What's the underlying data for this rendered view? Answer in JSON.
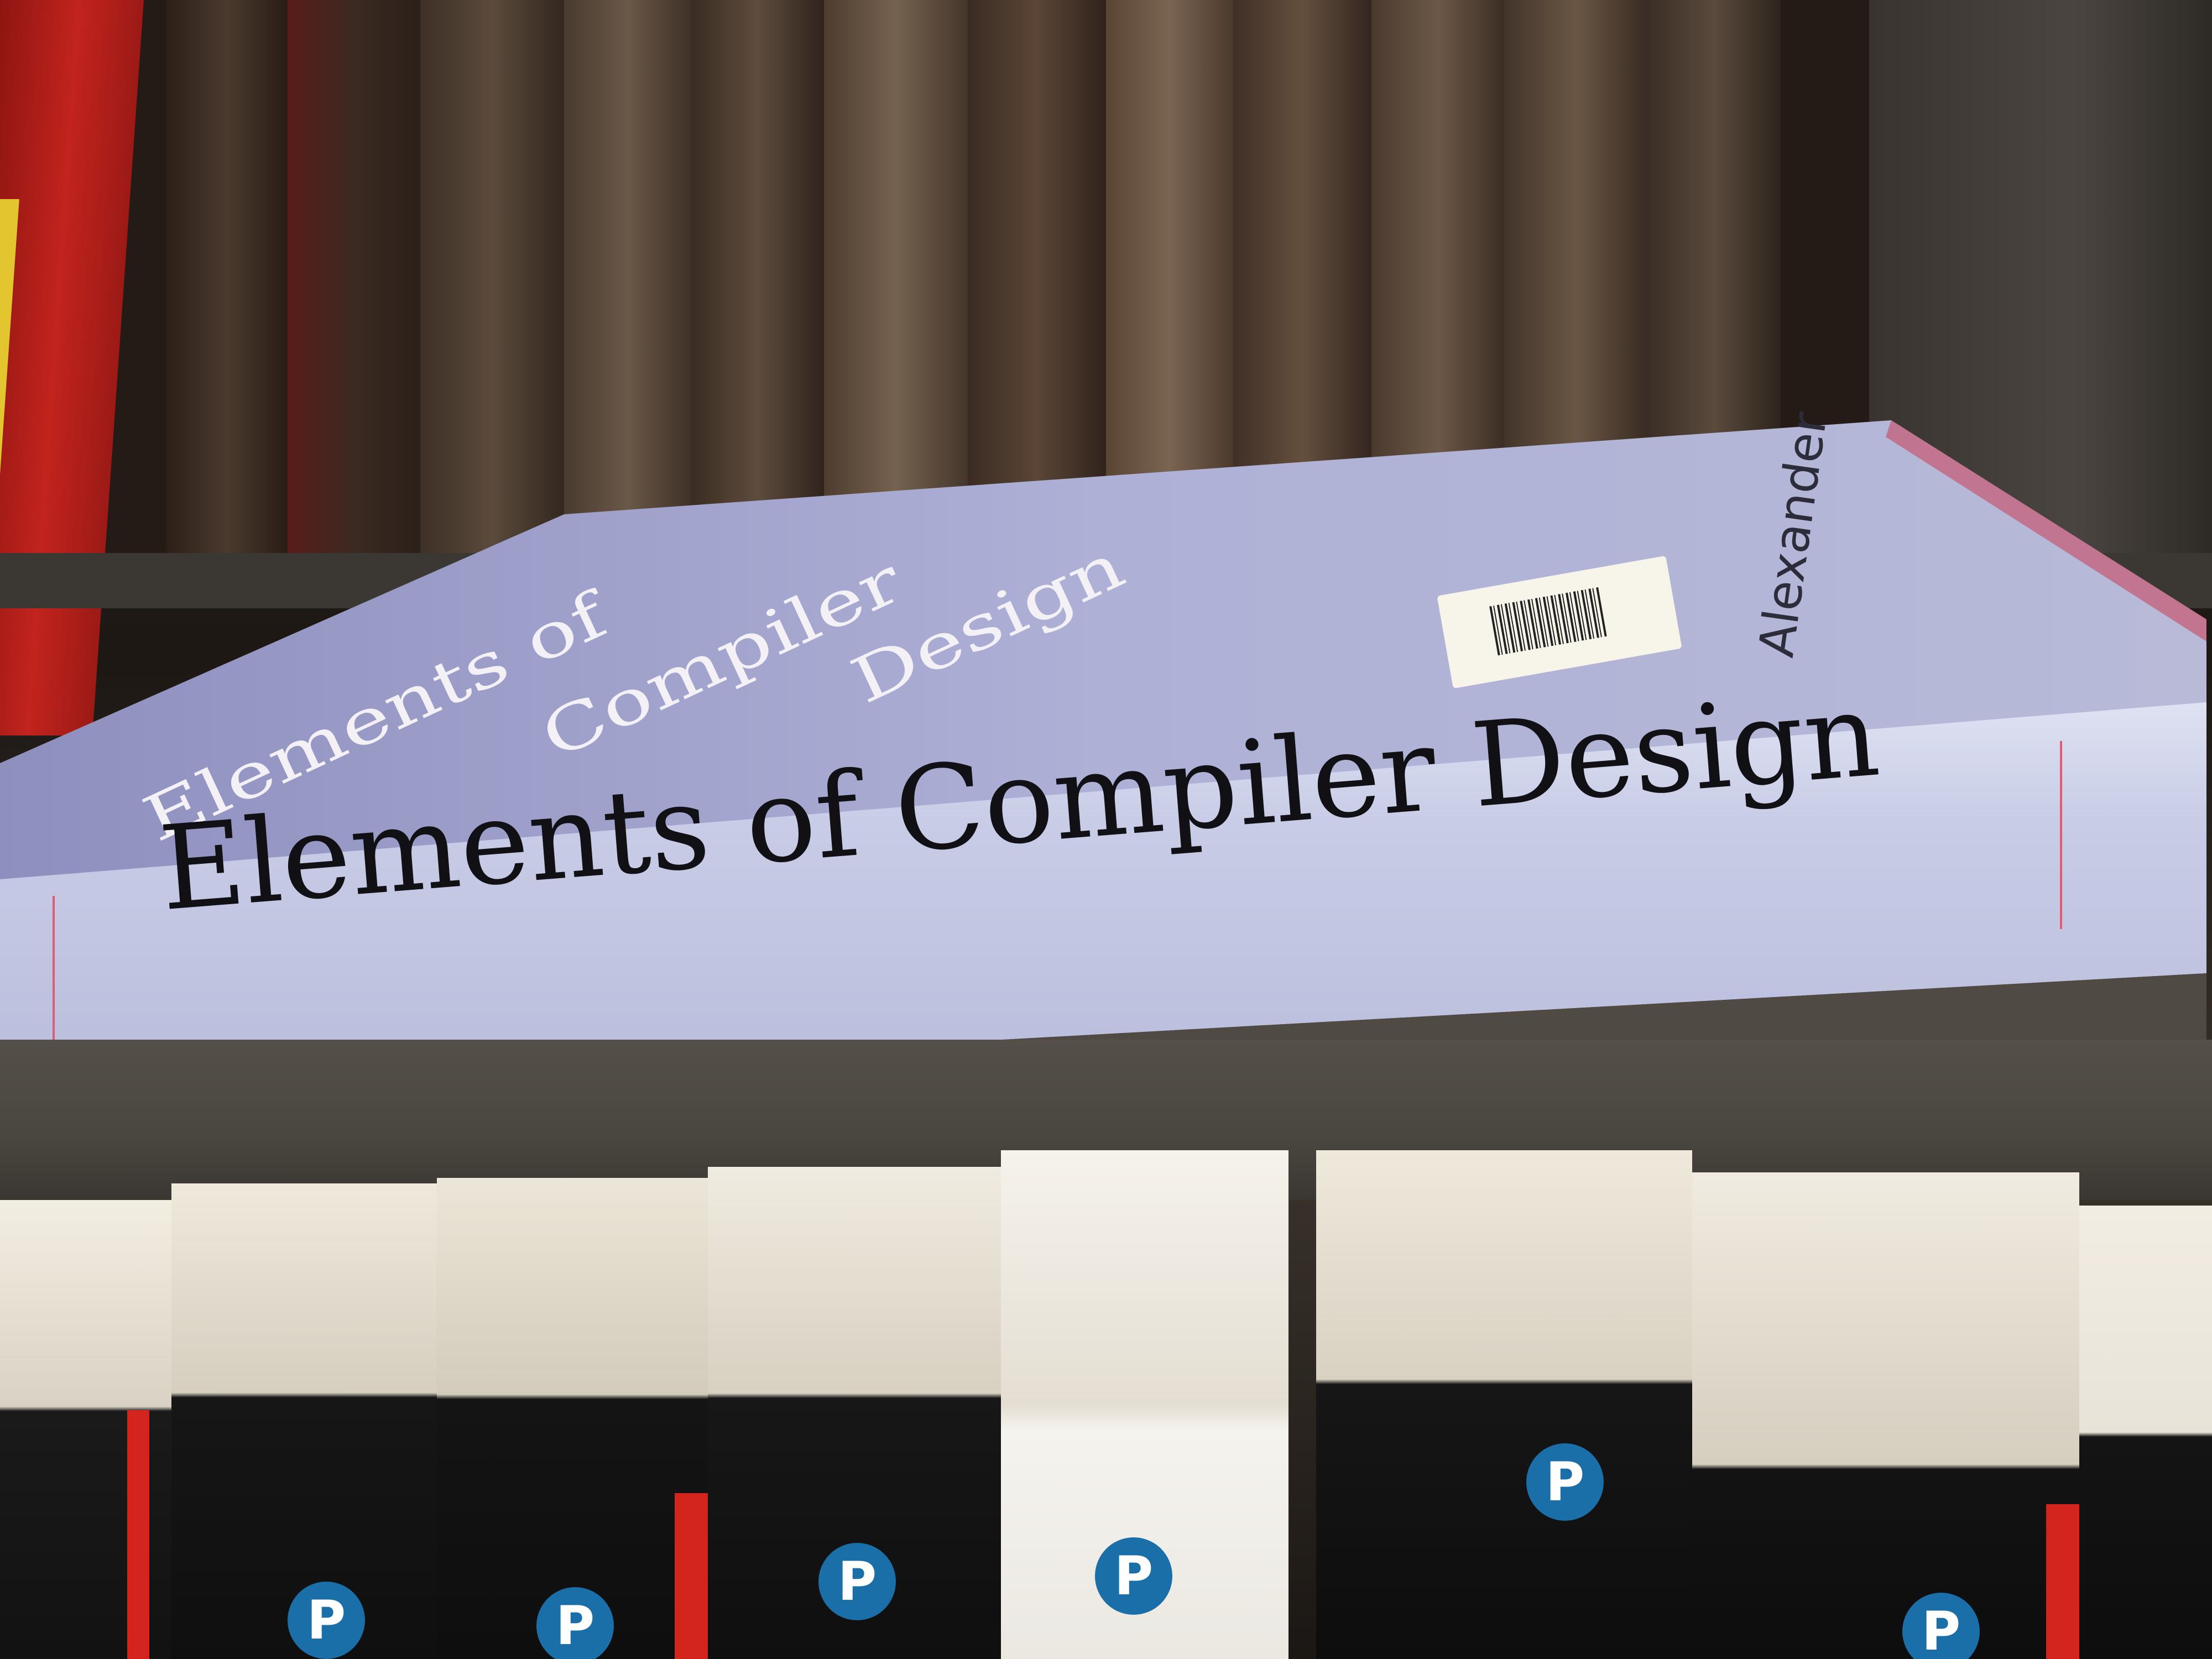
{
  "scene": {
    "description_free": true
  },
  "book": {
    "spine_title": "Elements of Compiler Design",
    "cover_title_lines": [
      "Elements of",
      "Compiler",
      "Design"
    ],
    "cover_author_fragment": "Alexander",
    "spine_color": "#c9cde6",
    "cover_color": "#9fa0cb"
  },
  "pearson_books": [
    {
      "logo": "P"
    },
    {
      "logo": "P"
    },
    {
      "logo": "P"
    },
    {
      "logo": "P"
    },
    {
      "logo": "P"
    },
    {
      "logo": "P"
    }
  ]
}
